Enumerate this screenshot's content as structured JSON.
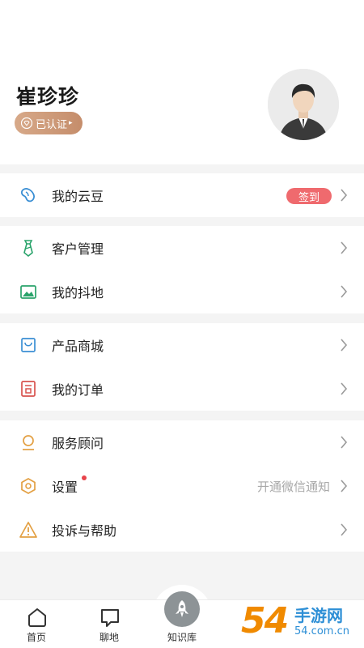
{
  "profile": {
    "name": "崔珍珍",
    "verified_label": "已认证"
  },
  "menu": {
    "beans": {
      "label": "我的云豆",
      "sign_label": "签到",
      "icon": "bean-icon"
    },
    "customers": {
      "label": "客户管理",
      "icon": "tie-icon"
    },
    "douqi": {
      "label": "我的抖地",
      "icon": "image-icon"
    },
    "shop": {
      "label": "产品商城",
      "icon": "bag-icon"
    },
    "orders": {
      "label": "我的订单",
      "icon": "order-icon"
    },
    "advisor": {
      "label": "服务顾问",
      "icon": "advisor-icon"
    },
    "settings": {
      "label": "设置",
      "right_text": "开通微信通知",
      "icon": "hex-gear-icon"
    },
    "help": {
      "label": "投诉与帮助",
      "icon": "warning-icon"
    }
  },
  "tabbar": {
    "home": "首页",
    "chat": "聊地",
    "kb": "知识库"
  },
  "watermark": {
    "num": "54",
    "brand": "手游网",
    "url": "54.com.cn"
  },
  "colors": {
    "accent_red": "#ef6a6e",
    "badge": "#c58d6b",
    "icon_blue": "#3b8fd4",
    "icon_green": "#2aa36b",
    "icon_orange": "#e3a043"
  }
}
